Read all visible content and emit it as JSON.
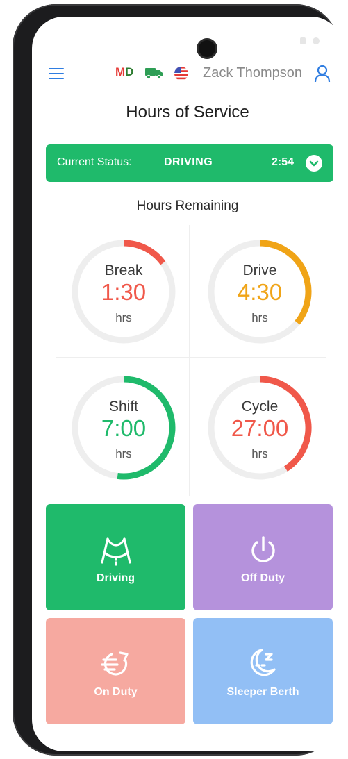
{
  "header": {
    "state_badge": {
      "first": "M",
      "second": "D"
    },
    "user_name": "Zack Thompson"
  },
  "page_title": "Hours of Service",
  "status": {
    "label": "Current Status:",
    "value": "DRIVING",
    "time": "2:54"
  },
  "hours_section_label": "Hours Remaining",
  "gauges": [
    {
      "name": "Break",
      "value": "1:30",
      "unit": "hrs",
      "fraction": 0.15,
      "color": "#f0584a"
    },
    {
      "name": "Drive",
      "value": "4:30",
      "unit": "hrs",
      "fraction": 0.36,
      "color": "#f0a417"
    },
    {
      "name": "Shift",
      "value": "7:00",
      "unit": "hrs",
      "fraction": 0.52,
      "color": "#1fba6b"
    },
    {
      "name": "Cycle",
      "value": "27:00",
      "unit": "hrs",
      "fraction": 0.41,
      "color": "#f0584a"
    }
  ],
  "tiles": [
    {
      "label": "Driving",
      "color": "#1fba6b",
      "icon": "road-icon"
    },
    {
      "label": "Off  Duty",
      "color": "#b592dc",
      "icon": "power-icon"
    },
    {
      "label": "On Duty",
      "color": "#f6a9a0",
      "icon": "clock-arrow-icon"
    },
    {
      "label": "Sleeper Berth",
      "color": "#92bff5",
      "icon": "moon-sleep-icon"
    }
  ],
  "colors": {
    "accent": "#2f7de1",
    "status_green": "#1fba6b",
    "track": "#eeeeee"
  }
}
